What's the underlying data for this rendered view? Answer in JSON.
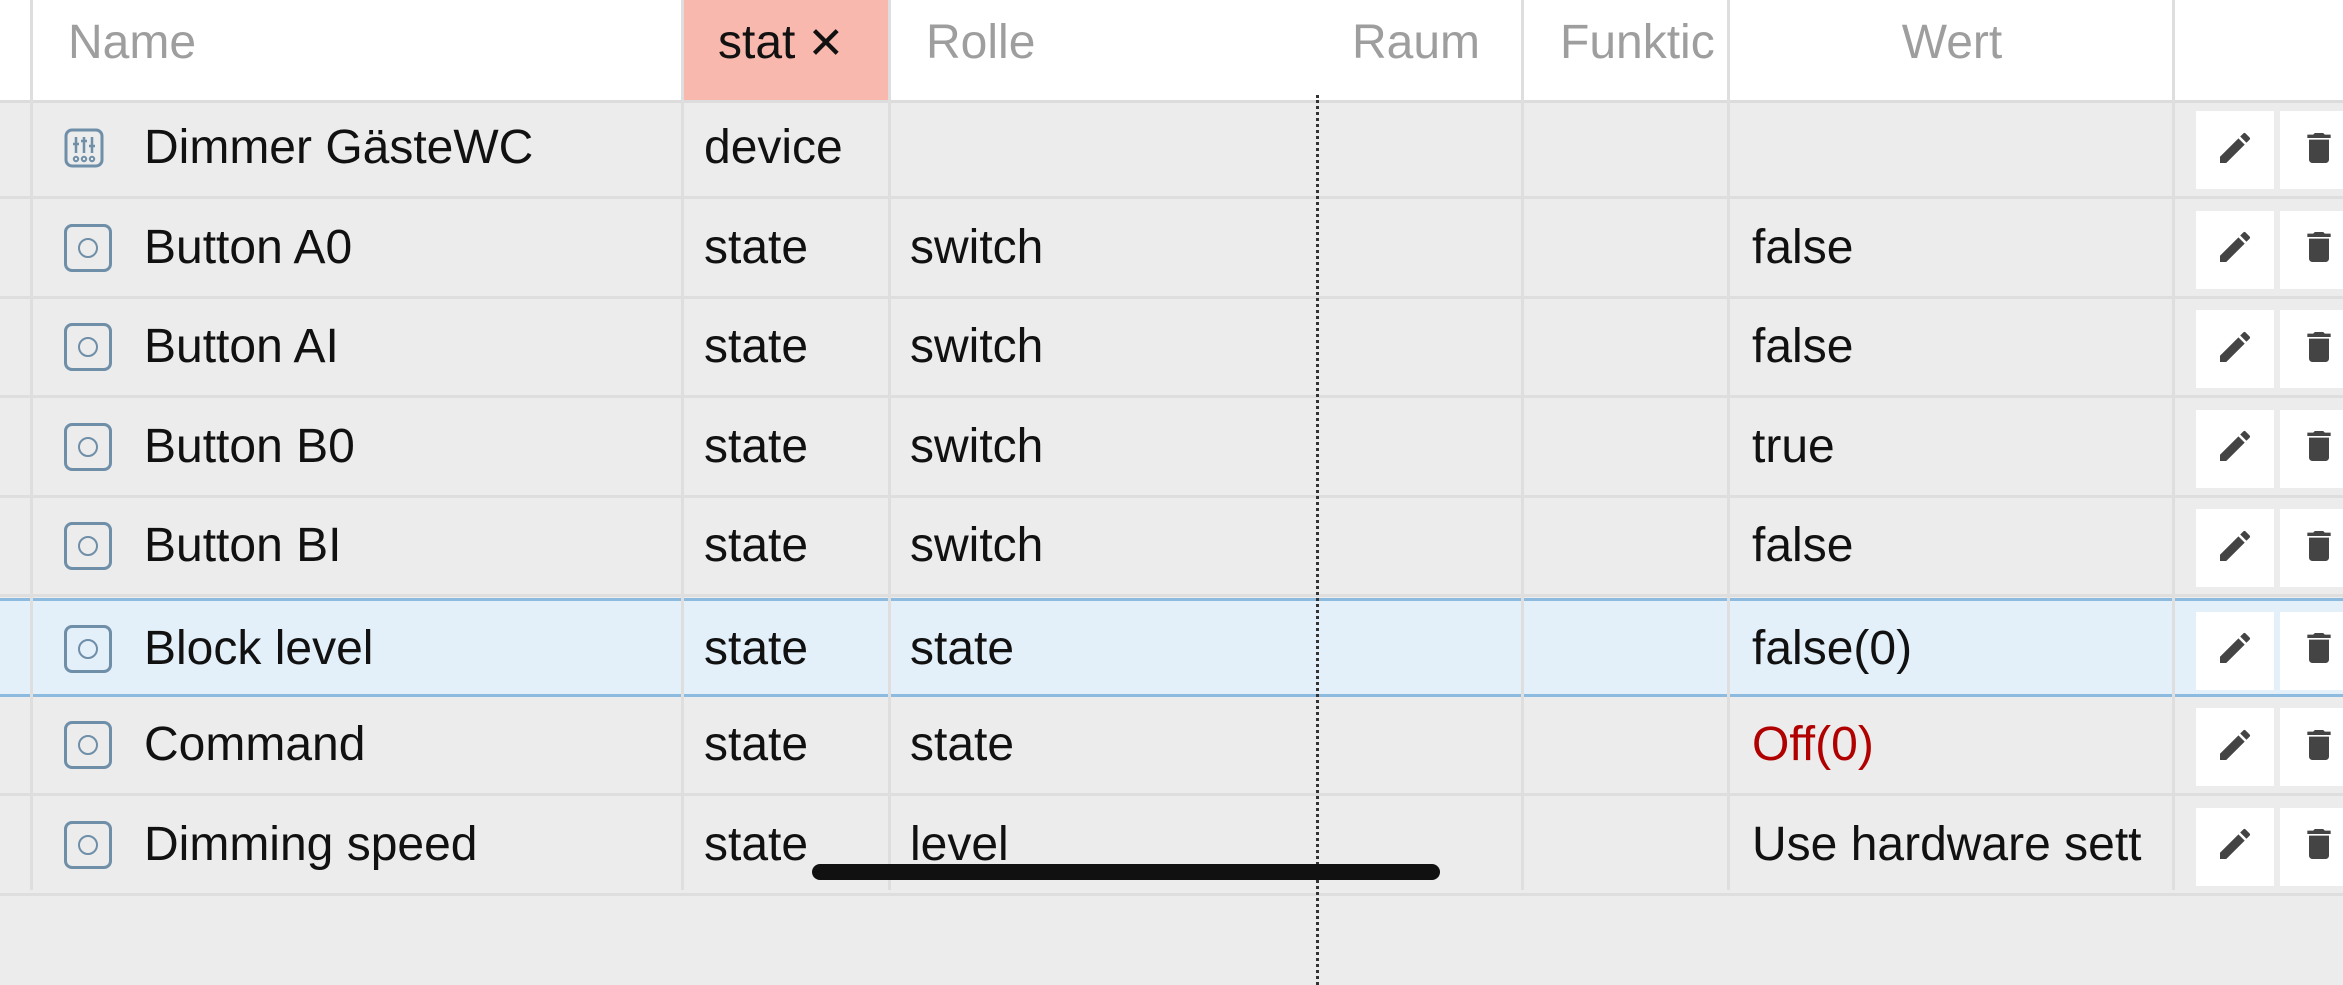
{
  "header": {
    "columns": {
      "name": "Name",
      "type": "stat",
      "role": "Rolle",
      "room": "Raum",
      "function": "Funktic",
      "value": "Wert"
    },
    "filter_clear_glyph": "✕"
  },
  "rows": [
    {
      "icon": "sliders-icon",
      "name": "Dimmer GästeWC",
      "type": "device",
      "role": "",
      "value": ""
    },
    {
      "icon": "state-icon",
      "name": "Button A0",
      "type": "state",
      "role": "switch",
      "value": "false"
    },
    {
      "icon": "state-icon",
      "name": "Button AI",
      "type": "state",
      "role": "switch",
      "value": "false"
    },
    {
      "icon": "state-icon",
      "name": "Button B0",
      "type": "state",
      "role": "switch",
      "value": "true"
    },
    {
      "icon": "state-icon",
      "name": "Button BI",
      "type": "state",
      "role": "switch",
      "value": "false"
    },
    {
      "icon": "state-icon",
      "name": "Block level",
      "type": "state",
      "role": "state",
      "value": "false(0)",
      "selected": true
    },
    {
      "icon": "state-icon",
      "name": "Command",
      "type": "state",
      "role": "state",
      "value": "Off(0)",
      "value_color": "#b00000"
    },
    {
      "icon": "state-icon",
      "name": "Dimming speed",
      "type": "state",
      "role": "level",
      "value": "Use hardware sett"
    }
  ],
  "colors": {
    "filter_highlight": "#f8b8ad",
    "selected_row": "#e3eff9",
    "icon_stroke": "#6f8ea8",
    "value_red": "#b00000"
  }
}
